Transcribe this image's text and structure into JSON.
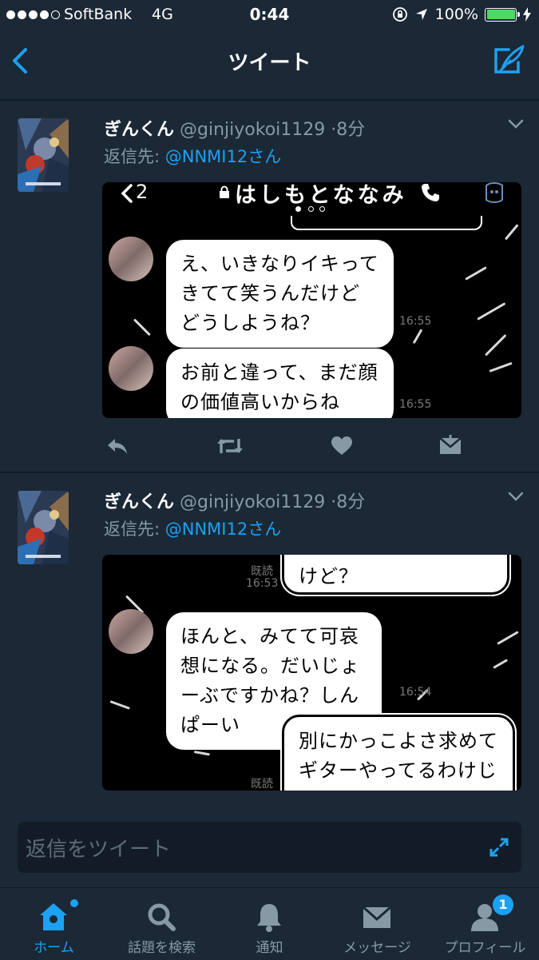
{
  "status_bar": {
    "carrier": "SoftBank",
    "network": "4G",
    "time": "0:44",
    "battery": "100%",
    "signal_bars": 4,
    "battery_level": 1.0
  },
  "nav": {
    "title": "ツイート",
    "back_icon": "chevron-left-icon",
    "compose_icon": "compose-tweet-icon"
  },
  "tweets": [
    {
      "name": "ぎんくん",
      "handle": "@ginjiyokoi1129",
      "time": "8分",
      "reply_label": "返信先: ",
      "reply_mention": "@NNMI12さん",
      "screenshot": {
        "header_name": "はしもとななみ",
        "back_count": "2",
        "messages": [
          {
            "text": "え、いきなりイキってきてて笑うんだけどどうしようね？",
            "time": "16:55"
          },
          {
            "text": "お前と違って、まだ顔の価値高いからね",
            "time": "16:55"
          }
        ]
      }
    },
    {
      "name": "ぎんくん",
      "handle": "@ginjiyokoi1129",
      "time": "8分",
      "reply_label": "返信先: ",
      "reply_mention": "@NNMI12さん",
      "screenshot": {
        "top_fragment": "けど？",
        "read_label_1": "既読",
        "read_time_1": "16:53",
        "messages": [
          {
            "text": "ほんと、みてて可哀想になる。だいじょーぶですかね？しんぱーい",
            "time": "16:54"
          },
          {
            "text": "別にかっこよさ求めてギターやってるわけじゃないし？",
            "time": ""
          }
        ],
        "read_label_2": "既読"
      }
    }
  ],
  "actions": [
    "reply-icon",
    "retweet-icon",
    "like-icon",
    "direct-message-icon"
  ],
  "reply_bar": {
    "placeholder": "返信をツイート"
  },
  "tabs": [
    {
      "label": "ホーム",
      "active": true
    },
    {
      "label": "話題を検索"
    },
    {
      "label": "通知"
    },
    {
      "label": "メッセージ"
    },
    {
      "label": "プロフィール",
      "badge": "1"
    }
  ],
  "colors": {
    "accent": "#1da1f2",
    "background": "#1b2836",
    "muted": "#8899a6"
  }
}
